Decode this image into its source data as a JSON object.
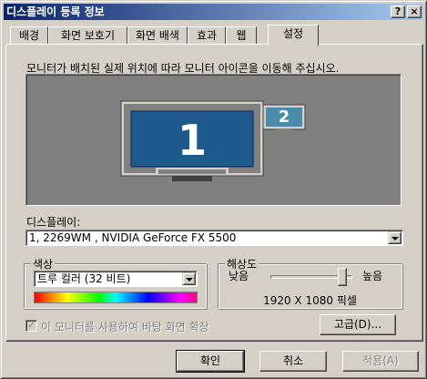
{
  "window": {
    "title": "디스플레이 등록 정보",
    "help_button": "?",
    "close_button": "×"
  },
  "tabs": [
    {
      "label": "배경"
    },
    {
      "label": "화면 보호기"
    },
    {
      "label": "화면 배색"
    },
    {
      "label": "효과"
    },
    {
      "label": "웹"
    },
    {
      "label": "설정",
      "active": true
    }
  ],
  "settings": {
    "instruction": "모니터가 배치된 실제 위치에 따라 모니터 아이콘을 이동해 주십시오.",
    "monitors": [
      {
        "number": "1",
        "primary": true
      },
      {
        "number": "2",
        "primary": false
      }
    ],
    "display_label": "디스플레이:",
    "display_value": "1, 2269WM , NVIDIA GeForce FX 5500",
    "color_group_title": "색상",
    "color_value": "트루 컬러 (32 비트)",
    "resolution_group_title": "해상도",
    "resolution_low": "낮음",
    "resolution_high": "높음",
    "resolution_value": "1920 X 1080 픽셀",
    "resolution_slider_fraction": 1.0,
    "extend_checkbox_label": "이 모니터를 사용하여 바탕 화면 확장",
    "extend_checked": true,
    "advanced_button": "고급(D)..."
  },
  "footer": {
    "ok": "확인",
    "cancel": "취소",
    "apply": "적용(A)"
  },
  "colors": {
    "titlebar_start": "#0a246a",
    "titlebar_end": "#a6caf0",
    "monitor_screen": "#1f5a8c",
    "monitor_number": "#ffffff",
    "background": "#d4d0c8"
  }
}
